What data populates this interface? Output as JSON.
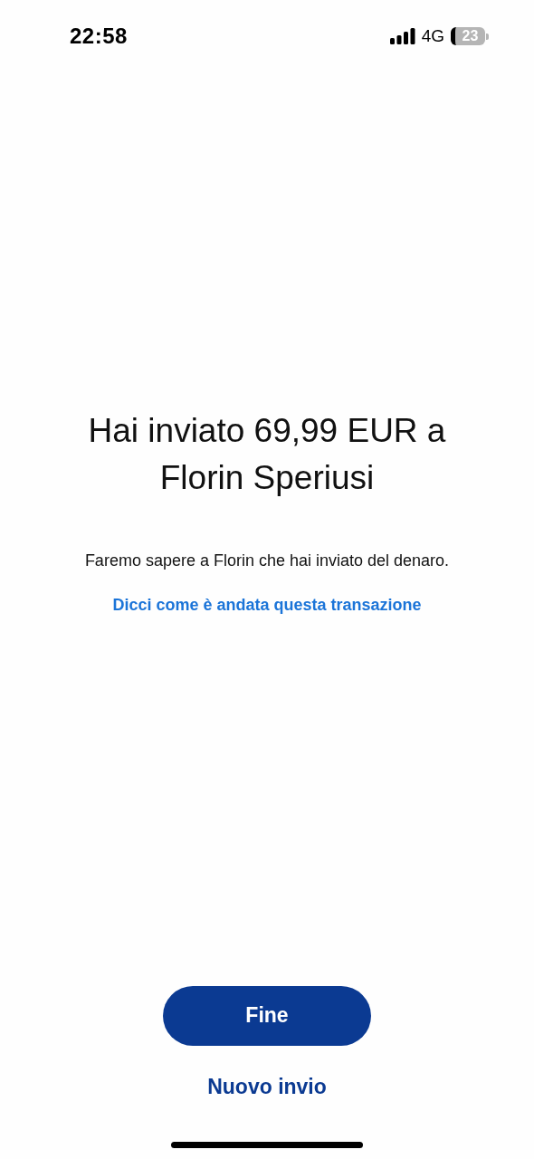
{
  "status_bar": {
    "time": "22:58",
    "network": "4G",
    "battery": "23"
  },
  "confirmation": {
    "title": "Hai inviato 69,99 EUR a Florin Speriusi",
    "message": "Faremo sapere a Florin che hai inviato del denaro.",
    "feedback_link": "Dicci come è andata questa transazione"
  },
  "buttons": [
    {
      "kind": "primary",
      "label": "Fine"
    },
    {
      "kind": "link",
      "label": "Nuovo invio"
    }
  ]
}
